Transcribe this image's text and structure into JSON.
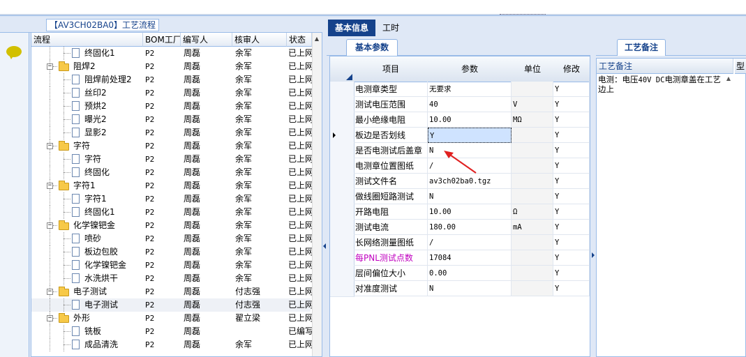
{
  "process_tree": {
    "group_label": "【AV3CH02BA0】工艺流程",
    "columns": [
      "流程",
      "BOM工厂",
      "编写人",
      "核审人",
      "状态"
    ],
    "rows": [
      {
        "name": "终固化1",
        "level": 2,
        "type": "doc",
        "bom": "P2",
        "writer": "周磊",
        "reviewer": "余军",
        "status": "已上网"
      },
      {
        "name": "阻焊2",
        "level": 1,
        "type": "folder",
        "bom": "P2",
        "writer": "周磊",
        "reviewer": "余军",
        "status": "已上网"
      },
      {
        "name": "阻焊前处理2",
        "level": 2,
        "type": "doc",
        "bom": "P2",
        "writer": "周磊",
        "reviewer": "余军",
        "status": "已上网"
      },
      {
        "name": "丝印2",
        "level": 2,
        "type": "doc",
        "bom": "P2",
        "writer": "周磊",
        "reviewer": "余军",
        "status": "已上网"
      },
      {
        "name": "预烘2",
        "level": 2,
        "type": "doc",
        "bom": "P2",
        "writer": "周磊",
        "reviewer": "余军",
        "status": "已上网"
      },
      {
        "name": "曝光2",
        "level": 2,
        "type": "doc",
        "bom": "P2",
        "writer": "周磊",
        "reviewer": "余军",
        "status": "已上网"
      },
      {
        "name": "显影2",
        "level": 2,
        "type": "doc",
        "bom": "P2",
        "writer": "周磊",
        "reviewer": "余军",
        "status": "已上网"
      },
      {
        "name": "字符",
        "level": 1,
        "type": "folder",
        "bom": "P2",
        "writer": "周磊",
        "reviewer": "余军",
        "status": "已上网"
      },
      {
        "name": "字符",
        "level": 2,
        "type": "doc",
        "bom": "P2",
        "writer": "周磊",
        "reviewer": "余军",
        "status": "已上网"
      },
      {
        "name": "终固化",
        "level": 2,
        "type": "doc",
        "bom": "P2",
        "writer": "周磊",
        "reviewer": "余军",
        "status": "已上网"
      },
      {
        "name": "字符1",
        "level": 1,
        "type": "folder",
        "bom": "P2",
        "writer": "周磊",
        "reviewer": "余军",
        "status": "已上网"
      },
      {
        "name": "字符1",
        "level": 2,
        "type": "doc",
        "bom": "P2",
        "writer": "周磊",
        "reviewer": "余军",
        "status": "已上网"
      },
      {
        "name": "终固化1",
        "level": 2,
        "type": "doc",
        "bom": "P2",
        "writer": "周磊",
        "reviewer": "余军",
        "status": "已上网"
      },
      {
        "name": "化学镍钯金",
        "level": 1,
        "type": "folder",
        "bom": "P2",
        "writer": "周磊",
        "reviewer": "余军",
        "status": "已上网"
      },
      {
        "name": "喷砂",
        "level": 2,
        "type": "doc",
        "bom": "P2",
        "writer": "周磊",
        "reviewer": "余军",
        "status": "已上网"
      },
      {
        "name": "板边包胶",
        "level": 2,
        "type": "doc",
        "bom": "P2",
        "writer": "周磊",
        "reviewer": "余军",
        "status": "已上网"
      },
      {
        "name": "化学镍钯金",
        "level": 2,
        "type": "doc",
        "bom": "P2",
        "writer": "周磊",
        "reviewer": "余军",
        "status": "已上网"
      },
      {
        "name": "水洗烘干",
        "level": 2,
        "type": "doc",
        "bom": "P2",
        "writer": "周磊",
        "reviewer": "余军",
        "status": "已上网"
      },
      {
        "name": "电子测试",
        "level": 1,
        "type": "folder",
        "bom": "P2",
        "writer": "周磊",
        "reviewer": "付志强",
        "status": "已上网"
      },
      {
        "name": "电子测试",
        "level": 2,
        "type": "doc",
        "bom": "P2",
        "writer": "周磊",
        "reviewer": "付志强",
        "status": "已上网",
        "selected": true
      },
      {
        "name": "外形",
        "level": 1,
        "type": "folder",
        "bom": "P2",
        "writer": "周磊",
        "reviewer": "翟立梁",
        "status": "已上网"
      },
      {
        "name": "铣板",
        "level": 2,
        "type": "doc",
        "bom": "P2",
        "writer": "周磊",
        "reviewer": "",
        "status": "已编写"
      },
      {
        "name": "成品清洗",
        "level": 2,
        "type": "doc",
        "bom": "P2",
        "writer": "周磊",
        "reviewer": "余军",
        "status": "已上网"
      }
    ]
  },
  "main_tabs": {
    "basic": "基本信息",
    "time": "工时"
  },
  "params": {
    "subtab": "基本参数",
    "columns": {
      "item": "项目",
      "param": "参数",
      "unit": "单位",
      "modify": "修改"
    },
    "rows": [
      {
        "item": "电测章类型",
        "param": "无要求",
        "unit": "",
        "modify": "Y"
      },
      {
        "item": "测试电压范围",
        "param": "40",
        "unit": "V",
        "modify": "Y"
      },
      {
        "item": "最小绝缘电阻",
        "param": "10.00",
        "unit": "MΩ",
        "modify": "Y"
      },
      {
        "item": "板边是否划线",
        "param": "Y",
        "unit": "",
        "modify": "Y",
        "current": true
      },
      {
        "item": "是否电测试后盖章",
        "param": "N",
        "unit": "",
        "modify": "Y"
      },
      {
        "item": "电测章位置图纸",
        "param": "/",
        "unit": "",
        "modify": "Y"
      },
      {
        "item": "测试文件名",
        "param": "av3ch02ba0.tgz",
        "unit": "",
        "modify": "Y"
      },
      {
        "item": "做线圈短路测试",
        "param": "N",
        "unit": "",
        "modify": "Y"
      },
      {
        "item": "开路电阻",
        "param": "10.00",
        "unit": "Ω",
        "modify": "Y"
      },
      {
        "item": "测试电流",
        "param": "180.00",
        "unit": "mA",
        "modify": "Y"
      },
      {
        "item": "长网络测量图纸",
        "param": "/",
        "unit": "",
        "modify": "Y"
      },
      {
        "item": "每PNL测试点数",
        "param": "17084",
        "unit": "",
        "modify": "Y",
        "highlight": true
      },
      {
        "item": "层间偏位大小",
        "param": "0.00",
        "unit": "",
        "modify": "Y"
      },
      {
        "item": "对准度测试",
        "param": "N",
        "unit": "",
        "modify": "Y"
      }
    ]
  },
  "notes": {
    "subtab": "工艺备注",
    "col1": "工艺备注",
    "col2": "型",
    "text_prefix": "电测：电压",
    "text_mono": "40V DC",
    "text_suffix": "电测章盖在工艺边上"
  },
  "colors": {
    "accent": "#15428b",
    "border": "#99bbe8",
    "highlight_text": "#c000c0",
    "arrow": "#e02020"
  }
}
